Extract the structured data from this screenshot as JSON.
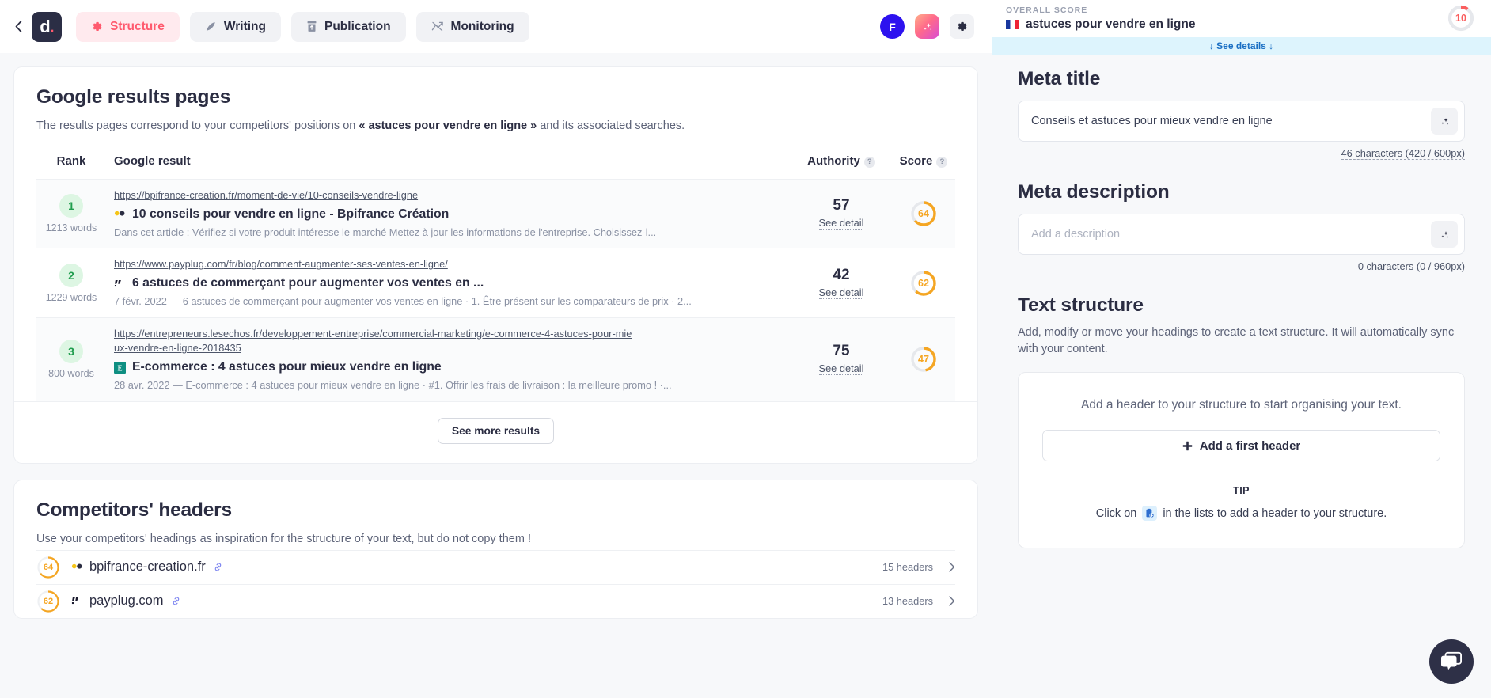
{
  "topbar": {
    "back_icon": "chevron-left-icon",
    "logo_text": "d",
    "logo_dot": ".",
    "tabs": [
      {
        "label": "Structure",
        "icon": "gear-icon",
        "active": true
      },
      {
        "label": "Writing",
        "icon": "pen-icon",
        "active": false
      },
      {
        "label": "Publication",
        "icon": "upload-box-icon",
        "active": false
      },
      {
        "label": "Monitoring",
        "icon": "trend-chart-icon",
        "active": false
      }
    ],
    "avatar_initial": "F",
    "ai_button_icon": "sparkles-icon",
    "settings_icon": "gear-icon"
  },
  "right_header": {
    "overall_score_label": "OVERALL SCORE",
    "keyword": "astuces pour vendre en ligne",
    "flag": "flag-fr",
    "score": "10",
    "score_percent": 10,
    "score_color": "#fa5e5e",
    "see_details": "↓ See details ↓"
  },
  "results_section": {
    "title": "Google results pages",
    "subtitle_pre": "The results pages correspond to your competitors' positions on ",
    "subtitle_bold": "« astuces pour vendre en ligne »",
    "subtitle_post": " and its associated searches.",
    "columns": {
      "rank": "Rank",
      "result": "Google result",
      "authority": "Authority",
      "score": "Score"
    },
    "rows": [
      {
        "rank": "1",
        "words": "1213 words",
        "url": "https://bpifrance-creation.fr/moment-de-vie/10-conseils-vendre-ligne",
        "title": "10 conseils pour vendre en ligne - Bpifrance Création",
        "description": "Dans cet article : Vérifiez si votre produit intéresse le marché Mettez à jour les informations de l'entreprise. Choisissez-l...",
        "favicon": "bpifrance-favicon",
        "authority": "57",
        "authority_link": "See detail",
        "score": "64",
        "score_percent": 64
      },
      {
        "rank": "2",
        "words": "1229 words",
        "url": "https://www.payplug.com/fr/blog/comment-augmenter-ses-ventes-en-ligne/",
        "title": "6 astuces de commerçant pour augmenter vos ventes en ...",
        "description": "7 févr. 2022 — 6 astuces de commerçant pour augmenter vos ventes en ligne · 1. Être présent sur les comparateurs de prix · 2...",
        "favicon": "payplug-favicon",
        "authority": "42",
        "authority_link": "See detail",
        "score": "62",
        "score_percent": 62
      },
      {
        "rank": "3",
        "words": "800 words",
        "url": "https://entrepreneurs.lesechos.fr/developpement-entreprise/commercial-marketing/e-commerce-4-astuces-pour-mieux-vendre-en-ligne-2018435",
        "title": "E-commerce : 4 astuces pour mieux vendre en ligne",
        "description": "28 avr. 2022 — E-commerce : 4 astuces pour mieux vendre en ligne · #1. Offrir les frais de livraison : la meilleure promo ! ·...",
        "favicon": "lesechos-favicon",
        "authority": "75",
        "authority_link": "See detail",
        "score": "47",
        "score_percent": 47
      }
    ],
    "see_more_label": "See more results"
  },
  "competitors_section": {
    "title": "Competitors' headers",
    "subtitle": "Use your competitors' headings as inspiration for the structure of your text, but do not copy them !",
    "rows": [
      {
        "score": "64",
        "score_percent": 64,
        "domain": "bpifrance-creation.fr",
        "favicon": "bpifrance-favicon",
        "headers_count": "15 headers"
      },
      {
        "score": "62",
        "score_percent": 62,
        "domain": "payplug.com",
        "favicon": "payplug-favicon",
        "headers_count": "13 headers"
      }
    ]
  },
  "meta_title": {
    "title": "Meta title",
    "value": "Conseils et astuces pour mieux vendre en ligne",
    "char_count": "46 characters (420 / 600px)"
  },
  "meta_description": {
    "title": "Meta description",
    "placeholder": "Add a description",
    "char_count": "0 characters (0 / 960px)"
  },
  "text_structure": {
    "title": "Text structure",
    "subtitle": "Add, modify or move your headings to create a text structure. It will automatically sync with your content.",
    "empty_hint": "Add a header to your structure to start organising your text.",
    "add_button": "Add a first header",
    "tip_label": "TIP",
    "tip_pre": "Click on",
    "tip_post": "in the lists to add a header to your structure."
  },
  "chat": {
    "icon": "chat-bubbles-icon"
  },
  "colors": {
    "accent_pink": "#ff5a6e",
    "score_orange": "#f5a623",
    "rank_green": "#1f9d4d",
    "navy": "#2b2d42"
  }
}
